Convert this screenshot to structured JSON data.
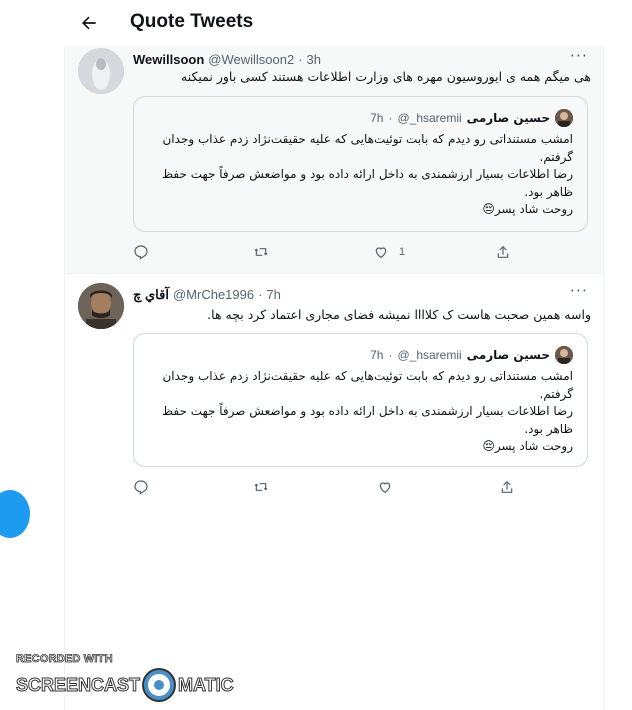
{
  "header": {
    "title": "Quote Tweets"
  },
  "tweets": [
    {
      "name": "Wewillsoon",
      "handle": "@Wewillsoon2",
      "time": "3h",
      "text": "هی میگم همه ی ایوروسیون مهره های وزارت اطلاعات هستند کسی باور نمیکنه",
      "quote": {
        "name": "حسین صارمی",
        "handle": "@_hsaremii",
        "time": "7h",
        "lines": [
          "امشب مستنداتی رو دیدم که بابت توئیت‌هایی که علیه حقیقت‌نژاد زدم عذاب وجدان گرفتم.",
          "رضا اطلاعات بسیار ارزشمندی به داخل ارائه داده بود و مواضعش صرفاً جهت حفظ ظاهر بود.",
          "روحت شاد پسر😔"
        ]
      },
      "actions": {
        "reply": "",
        "retweet": "",
        "like": "1",
        "share": ""
      }
    },
    {
      "name": "آقاي چ",
      "handle": "@MrChe1996",
      "time": "7h",
      "text": "واسه همین صحبت هاست ک کلاااا نمیشه فضای مجاری اعتماد کرد بچه ها.",
      "quote": {
        "name": "حسین صارمی",
        "handle": "@_hsaremii",
        "time": "7h",
        "lines": [
          "امشب مستنداتی رو دیدم که بابت توئیت‌هایی که علیه حقیقت‌نژاد زدم عذاب وجدان گرفتم.",
          "رضا اطلاعات بسیار ارزشمندی به داخل ارائه داده بود و مواضعش صرفاً جهت حفظ ظاهر بود.",
          "روحت شاد پسر😔"
        ]
      },
      "actions": {
        "reply": "",
        "retweet": "",
        "like": "",
        "share": ""
      }
    }
  ],
  "watermark": {
    "recorded": "RECORDED WITH",
    "brand_left": "SCREENCAST",
    "brand_right": "MATIC"
  },
  "colors": {
    "accent": "#1d9bf0",
    "muted": "#536471",
    "border": "#cfd9de"
  },
  "icons": [
    "back-arrow-icon",
    "more-icon",
    "reply-icon",
    "retweet-icon",
    "like-icon",
    "share-icon"
  ]
}
